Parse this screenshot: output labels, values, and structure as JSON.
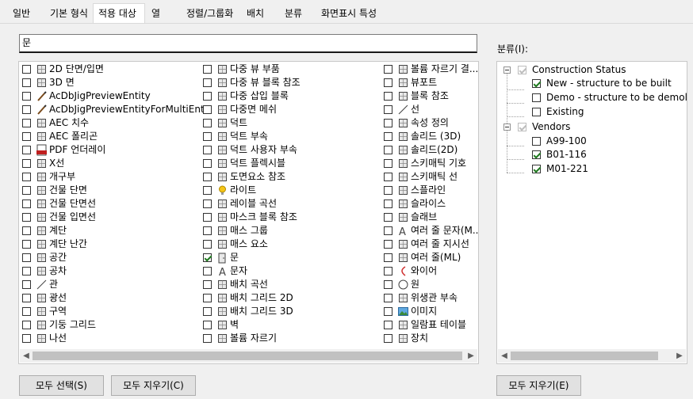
{
  "tabs": [
    "일반",
    "기본 형식",
    "적용 대상",
    "열",
    "정렬/그룹화",
    "배치",
    "분류",
    "화면표시 특성"
  ],
  "filter": {
    "value": "문"
  },
  "columns": [
    [
      {
        "label": "2D 단면/입면",
        "checked": false,
        "icon": "section-2d-icon"
      },
      {
        "label": "3D 면",
        "checked": false,
        "icon": "face-3d-icon"
      },
      {
        "label": "AcDbJigPreviewEntity",
        "checked": false,
        "icon": "brush-icon"
      },
      {
        "label": "AcDbJigPreviewEntityForMultiEnts",
        "checked": false,
        "icon": "brush-icon"
      },
      {
        "label": "AEC 치수",
        "checked": false,
        "icon": "dimension-icon"
      },
      {
        "label": "AEC 폴리곤",
        "checked": false,
        "icon": "polygon-icon"
      },
      {
        "label": "PDF 언더레이",
        "checked": false,
        "icon": "pdf-icon"
      },
      {
        "label": "X선",
        "checked": false,
        "icon": "xline-icon"
      },
      {
        "label": "개구부",
        "checked": false,
        "icon": "opening-icon"
      },
      {
        "label": "건물 단면",
        "checked": false,
        "icon": "building-section-icon"
      },
      {
        "label": "건물 단면선",
        "checked": false,
        "icon": "section-line-icon"
      },
      {
        "label": "건물 입면선",
        "checked": false,
        "icon": "elevation-line-icon"
      },
      {
        "label": "계단",
        "checked": false,
        "icon": "stair-icon"
      },
      {
        "label": "계단 난간",
        "checked": false,
        "icon": "railing-icon"
      },
      {
        "label": "공간",
        "checked": false,
        "icon": "space-icon"
      },
      {
        "label": "공차",
        "checked": false,
        "icon": "tolerance-icon"
      },
      {
        "label": "관",
        "checked": false,
        "icon": "line-icon"
      },
      {
        "label": "광선",
        "checked": false,
        "icon": "ray-icon"
      },
      {
        "label": "구역",
        "checked": false,
        "icon": "zone-icon"
      },
      {
        "label": "기둥 그리드",
        "checked": false,
        "icon": "column-grid-icon"
      },
      {
        "label": "나선",
        "checked": false,
        "icon": "helix-icon"
      }
    ],
    [
      {
        "label": "다중 뷰 부품",
        "checked": false,
        "icon": "mv-part-icon"
      },
      {
        "label": "다중 뷰 블록 참조",
        "checked": false,
        "icon": "mv-block-icon"
      },
      {
        "label": "다중 삽입 블록",
        "checked": false,
        "icon": "minsert-icon"
      },
      {
        "label": "다중면 메쉬",
        "checked": false,
        "icon": "polyface-icon"
      },
      {
        "label": "덕트",
        "checked": false,
        "icon": "duct-icon"
      },
      {
        "label": "덕트 부속",
        "checked": false,
        "icon": "duct-fitting-icon"
      },
      {
        "label": "덕트 사용자 부속",
        "checked": false,
        "icon": "duct-custom-icon"
      },
      {
        "label": "덕트 플렉시블",
        "checked": false,
        "icon": "flex-duct-icon"
      },
      {
        "label": "도면요소 참조",
        "checked": false,
        "icon": "element-ref-icon"
      },
      {
        "label": "라이트",
        "checked": false,
        "icon": "light-icon"
      },
      {
        "label": "레이블 곡선",
        "checked": false,
        "icon": "label-curve-icon"
      },
      {
        "label": "마스크 블록 참조",
        "checked": false,
        "icon": "mask-block-icon"
      },
      {
        "label": "매스 그룹",
        "checked": false,
        "icon": "mass-group-icon"
      },
      {
        "label": "매스 요소",
        "checked": false,
        "icon": "mass-element-icon"
      },
      {
        "label": "문",
        "checked": true,
        "icon": "door-icon"
      },
      {
        "label": "문자",
        "checked": false,
        "icon": "text-icon"
      },
      {
        "label": "배치 곡선",
        "checked": false,
        "icon": "layout-curve-icon"
      },
      {
        "label": "배치 그리드 2D",
        "checked": false,
        "icon": "grid-2d-icon"
      },
      {
        "label": "배치 그리드 3D",
        "checked": false,
        "icon": "grid-3d-icon"
      },
      {
        "label": "벽",
        "checked": false,
        "icon": "wall-icon"
      },
      {
        "label": "볼륨 자르기",
        "checked": false,
        "icon": "volume-clip-icon"
      }
    ],
    [
      {
        "label": "볼륨 자르기 결...",
        "checked": false,
        "icon": "volume-clip-icon"
      },
      {
        "label": "뷰포트",
        "checked": false,
        "icon": "viewport-icon"
      },
      {
        "label": "블록 참조",
        "checked": false,
        "icon": "block-ref-icon"
      },
      {
        "label": "선",
        "checked": false,
        "icon": "line-icon"
      },
      {
        "label": "속성 정의",
        "checked": false,
        "icon": "attribute-icon"
      },
      {
        "label": "솔리드 (3D)",
        "checked": false,
        "icon": "solid-3d-icon"
      },
      {
        "label": "솔리드(2D)",
        "checked": false,
        "icon": "solid-2d-icon"
      },
      {
        "label": "스키매틱 기호",
        "checked": false,
        "icon": "schematic-symbol-icon"
      },
      {
        "label": "스키매틱 선",
        "checked": false,
        "icon": "schematic-line-icon"
      },
      {
        "label": "스플라인",
        "checked": false,
        "icon": "spline-icon"
      },
      {
        "label": "슬라이스",
        "checked": false,
        "icon": "slice-icon"
      },
      {
        "label": "슬래브",
        "checked": false,
        "icon": "slab-icon"
      },
      {
        "label": "여러 줄 문자(M...",
        "checked": false,
        "icon": "mtext-icon"
      },
      {
        "label": "여러 줄 지시선",
        "checked": false,
        "icon": "mleader-icon"
      },
      {
        "label": "여러 줄(ML)",
        "checked": false,
        "icon": "mline-icon"
      },
      {
        "label": "와이어",
        "checked": false,
        "icon": "wire-icon"
      },
      {
        "label": "원",
        "checked": false,
        "icon": "circle-icon"
      },
      {
        "label": "위생관 부속",
        "checked": false,
        "icon": "plumbing-fitting-icon"
      },
      {
        "label": "이미지",
        "checked": false,
        "icon": "image-icon"
      },
      {
        "label": "일람표 테이블",
        "checked": false,
        "icon": "schedule-table-icon"
      },
      {
        "label": "장치",
        "checked": false,
        "icon": "device-icon"
      }
    ]
  ],
  "classification": {
    "label": "분류(I):",
    "tree": [
      {
        "label": "Construction Status",
        "checked": true,
        "children": [
          {
            "label": "New - structure to be built",
            "checked": true
          },
          {
            "label": "Demo - structure to be demolish",
            "checked": false
          },
          {
            "label": "Existing",
            "checked": false
          }
        ]
      },
      {
        "label": "Vendors",
        "checked": true,
        "children": [
          {
            "label": "A99-100",
            "checked": false
          },
          {
            "label": "B01-116",
            "checked": true
          },
          {
            "label": "M01-221",
            "checked": true
          }
        ]
      }
    ]
  },
  "buttons": {
    "select_all": "모두 선택(S)",
    "clear_all_left": "모두 지우기(C)",
    "clear_all_right": "모두 지우기(E)"
  }
}
